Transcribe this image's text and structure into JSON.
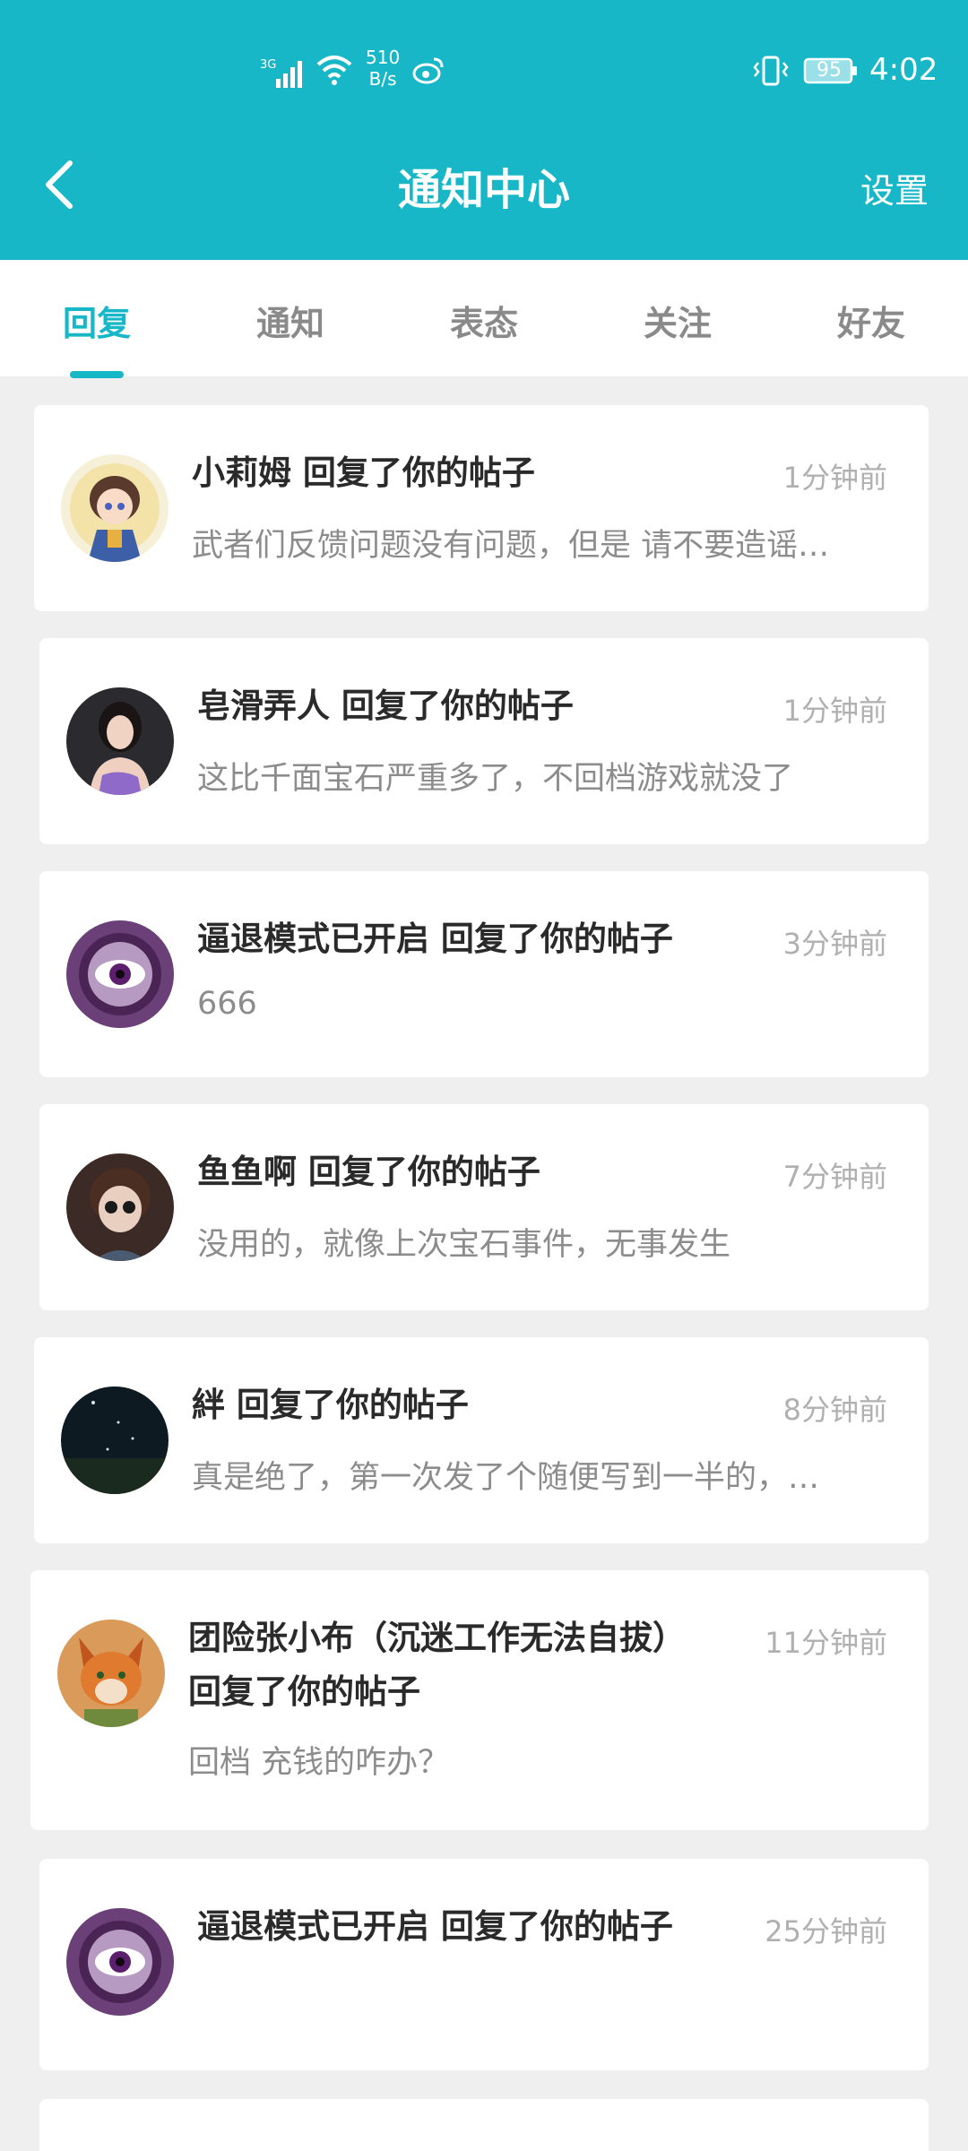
{
  "status_bar": {
    "network": "3G",
    "speed_value": "510",
    "speed_unit": "B/s",
    "battery": "95",
    "time": "4:02"
  },
  "nav": {
    "title": "通知中心",
    "settings": "设置"
  },
  "tabs": [
    {
      "label": "回复",
      "active": true
    },
    {
      "label": "通知",
      "active": false
    },
    {
      "label": "表态",
      "active": false
    },
    {
      "label": "关注",
      "active": false
    },
    {
      "label": "好友",
      "active": false
    }
  ],
  "notifications": [
    {
      "title": "小莉姆 回复了你的帖子",
      "time": "1分钟前",
      "message": "武者们反馈问题没有问题，但是 请不要造谣…",
      "avatar": "anime-girl-avatar"
    },
    {
      "title": "皂滑弄人 回复了你的帖子",
      "time": "1分钟前",
      "message": "这比千面宝石严重多了，不回档游戏就没了",
      "avatar": "woman-photo-avatar"
    },
    {
      "title": "逼退模式已开启 回复了你的帖子",
      "time": "3分钟前",
      "message": "666",
      "avatar": "purple-eye-avatar"
    },
    {
      "title": "鱼鱼啊 回复了你的帖子",
      "time": "7分钟前",
      "message": "没用的，就像上次宝石事件，无事发生",
      "avatar": "doll-avatar"
    },
    {
      "title": "絆 回复了你的帖子",
      "time": "8分钟前",
      "message": "真是绝了，第一次发了个随便写到一半的，…",
      "avatar": "night-sky-avatar"
    },
    {
      "title": "团险张小布（沉迷工作无法自拔） 回复了你的帖子",
      "time": "11分钟前",
      "message": "回档 充钱的咋办？",
      "avatar": "fox-avatar"
    },
    {
      "title": "逼退模式已开启 回复了你的帖子",
      "time": "25分钟前",
      "message": "",
      "avatar": "purple-eye-avatar"
    }
  ],
  "colors": {
    "accent": "#17b7c8",
    "background": "#efefef"
  }
}
